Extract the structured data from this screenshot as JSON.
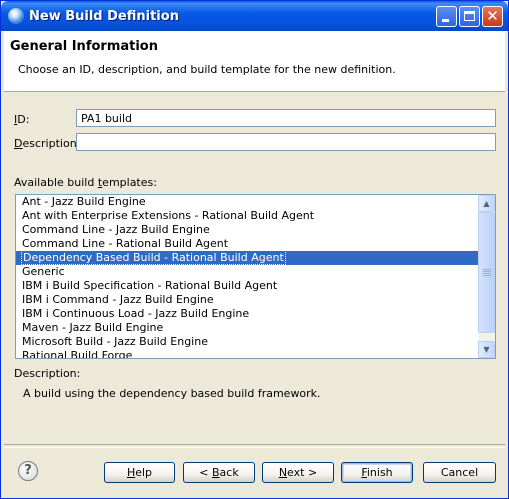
{
  "window": {
    "title": "New Build Definition"
  },
  "header": {
    "title": "General Information",
    "description": "Choose an ID, description, and build template for the new definition."
  },
  "form": {
    "id_label": "ID:",
    "id_value": "PA1 build",
    "description_label": "Description:",
    "description_value": ""
  },
  "templates": {
    "label": "Available build templates:",
    "items": [
      "Ant - Jazz Build Engine",
      "Ant with Enterprise Extensions - Rational Build Agent",
      "Command Line - Jazz Build Engine",
      "Command Line - Rational Build Agent",
      "Dependency Based Build - Rational Build Agent",
      "Generic",
      "IBM i Build Specification - Rational Build Agent",
      "IBM i Command - Jazz Build Engine",
      "IBM i Continuous Load - Jazz Build Engine",
      "Maven - Jazz Build Engine",
      "Microsoft Build - Jazz Build Engine",
      "Rational Build Forge"
    ],
    "selected": "Dependency Based Build - Rational Build Agent"
  },
  "template_description": {
    "label": "Description:",
    "text": "A build using the dependency based build framework."
  },
  "buttons": {
    "help": "Help",
    "back": "< Back",
    "next": "Next >",
    "finish": "Finish",
    "cancel": "Cancel"
  },
  "icons": {
    "app": "eclipse-globe-icon",
    "help": "question-mark-icon",
    "minimize": "minimize-icon",
    "maximize": "maximize-icon",
    "close": "close-icon"
  },
  "colors": {
    "titlebar": "#0551DC",
    "selection": "#316AC5",
    "dialog_bg": "#ECE9D8"
  }
}
